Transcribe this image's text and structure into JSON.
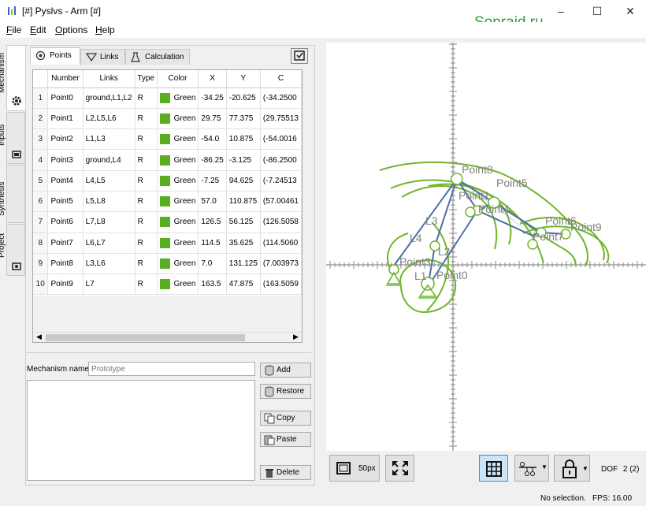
{
  "window": {
    "title": "[#] Pyslvs - Arm [#]",
    "watermark": "Sonraid.ru",
    "controls": [
      "minimize",
      "maximize",
      "close"
    ]
  },
  "menu": [
    {
      "accel": "F",
      "rest": "ile"
    },
    {
      "accel": "E",
      "rest": "dit"
    },
    {
      "accel": "O",
      "rest": "ptions"
    },
    {
      "accel": "H",
      "rest": "elp"
    }
  ],
  "side_tabs": [
    "Mechanism",
    "Inputs",
    "Synthesis",
    "Project"
  ],
  "panel_tabs": [
    "Points",
    "Links",
    "Calculation"
  ],
  "table": {
    "columns": [
      "",
      "Number",
      "Links",
      "Type",
      "Color",
      "X",
      "Y",
      "C"
    ],
    "rows": [
      {
        "n": "1",
        "number": "Point0",
        "links": "ground,L1,L2",
        "type": "R",
        "color": "Green",
        "x": "-34.25",
        "y": "-20.625",
        "c": "(-34.2500"
      },
      {
        "n": "2",
        "number": "Point1",
        "links": "L2,L5,L6",
        "type": "R",
        "color": "Green",
        "x": "29.75",
        "y": "77.375",
        "c": "(29.75513"
      },
      {
        "n": "3",
        "number": "Point2",
        "links": "L1,L3",
        "type": "R",
        "color": "Green",
        "x": "-54.0",
        "y": "10.875",
        "c": "(-54.0016"
      },
      {
        "n": "4",
        "number": "Point3",
        "links": "ground,L4",
        "type": "R",
        "color": "Green",
        "x": "-86.25",
        "y": "-3.125",
        "c": "(-86.2500"
      },
      {
        "n": "5",
        "number": "Point4",
        "links": "L4,L5",
        "type": "R",
        "color": "Green",
        "x": "-7.25",
        "y": "94.625",
        "c": "(-7.24513"
      },
      {
        "n": "6",
        "number": "Point5",
        "links": "L5,L8",
        "type": "R",
        "color": "Green",
        "x": "57.0",
        "y": "110.875",
        "c": "(57.00461"
      },
      {
        "n": "7",
        "number": "Point6",
        "links": "L7,L8",
        "type": "R",
        "color": "Green",
        "x": "126.5",
        "y": "56.125",
        "c": "(126.5058"
      },
      {
        "n": "8",
        "number": "Point7",
        "links": "L6,L7",
        "type": "R",
        "color": "Green",
        "x": "114.5",
        "y": "35.625",
        "c": "(114.5060"
      },
      {
        "n": "9",
        "number": "Point8",
        "links": "L3,L6",
        "type": "R",
        "color": "Green",
        "x": "7.0",
        "y": "131.125",
        "c": "(7.003973"
      },
      {
        "n": "10",
        "number": "Point9",
        "links": "L7",
        "type": "R",
        "color": "Green",
        "x": "163.5",
        "y": "47.875",
        "c": "(163.5059"
      }
    ],
    "swatch_color": "#5aae22"
  },
  "mechanism": {
    "name_label": "Mechanism name:",
    "name_placeholder": "Prototype",
    "buttons": {
      "add": "Add",
      "restore": "Restore",
      "copy": "Copy",
      "paste": "Paste",
      "delete": "Delete"
    }
  },
  "canvas": {
    "point_labels": [
      "Point8",
      "Point5",
      "Point1",
      "Point4",
      "Point6",
      "Point9",
      "Point7",
      "L3",
      "L4",
      "L2",
      "Point3",
      "L1",
      "Point0"
    ],
    "link_color": "#4e6fa6",
    "path_color": "#6fb52c",
    "label_color": "#808080"
  },
  "toolbar": {
    "zoom": "50px",
    "dof_label": "DOF",
    "dof_value": "2 (2)"
  },
  "status": {
    "selection": "No selection.",
    "fps": "FPS: 16.00"
  }
}
